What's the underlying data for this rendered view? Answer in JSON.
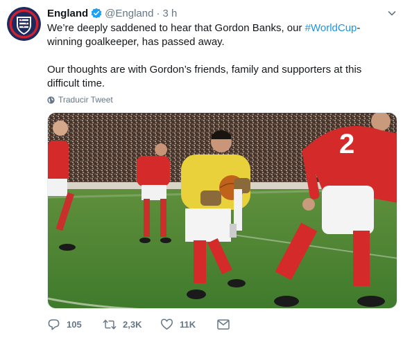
{
  "tweet": {
    "author_name": "England",
    "author_handle": "@England",
    "separator": "·",
    "time": "3 h",
    "text_part1": "We’re deeply saddened to hear that Gordon Banks, our ",
    "hashtag": "#WorldCup",
    "text_part2": "-winning goalkeeper, has passed away.",
    "text_para2": "Our thoughts are with Gordon’s friends, family and supporters at this difficult time.",
    "translate_label": "Traducir Tweet",
    "jersey_number": "2"
  },
  "actions": {
    "reply_count": "105",
    "retweet_count": "2,3K",
    "like_count": "11K"
  },
  "colors": {
    "link": "#1b95e0",
    "muted": "#657786",
    "verified": "#1da1f2",
    "badge_navy": "#1c2a5e",
    "badge_red": "#cf2030"
  },
  "icons": [
    "three-lions-crest-icon",
    "verified-badge-icon",
    "chevron-down-icon",
    "globe-icon",
    "reply-icon",
    "retweet-icon",
    "heart-icon",
    "envelope-icon"
  ]
}
